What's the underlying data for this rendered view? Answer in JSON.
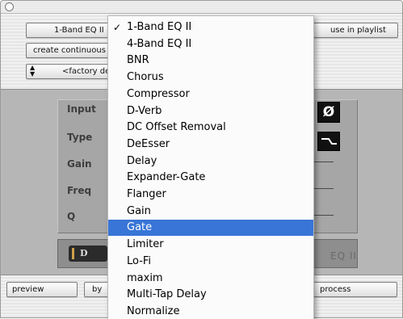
{
  "toolbar": {
    "insert_selector": "1-Band EQ II",
    "use_in_playlist": "use in playlist",
    "create_continuous": "create continuous file",
    "preset_selector": "<factory default>"
  },
  "plugin": {
    "labels": [
      "Input",
      "Type",
      "Gain",
      "Freq",
      "Q"
    ],
    "phase_symbol": "Ø",
    "brand_badge": "D",
    "faded_name": "EQ II"
  },
  "bottom_buttons": {
    "preview": "preview",
    "bypass": "by",
    "process": "process"
  },
  "menu": {
    "selected_index": 12,
    "checked_index": 0,
    "check_glyph": "✓",
    "items": [
      "1-Band EQ II",
      "4-Band EQ II",
      "BNR",
      "Chorus",
      "Compressor",
      "D-Verb",
      "DC Offset Removal",
      "DeEsser",
      "Delay",
      "Expander-Gate",
      "Flanger",
      "Gain",
      "Gate",
      "Limiter",
      "Lo-Fi",
      "maxim",
      "Multi-Tap Delay",
      "Normalize"
    ]
  },
  "colors": {
    "highlight": "#3875d7",
    "panel": "#b6b6b6"
  }
}
